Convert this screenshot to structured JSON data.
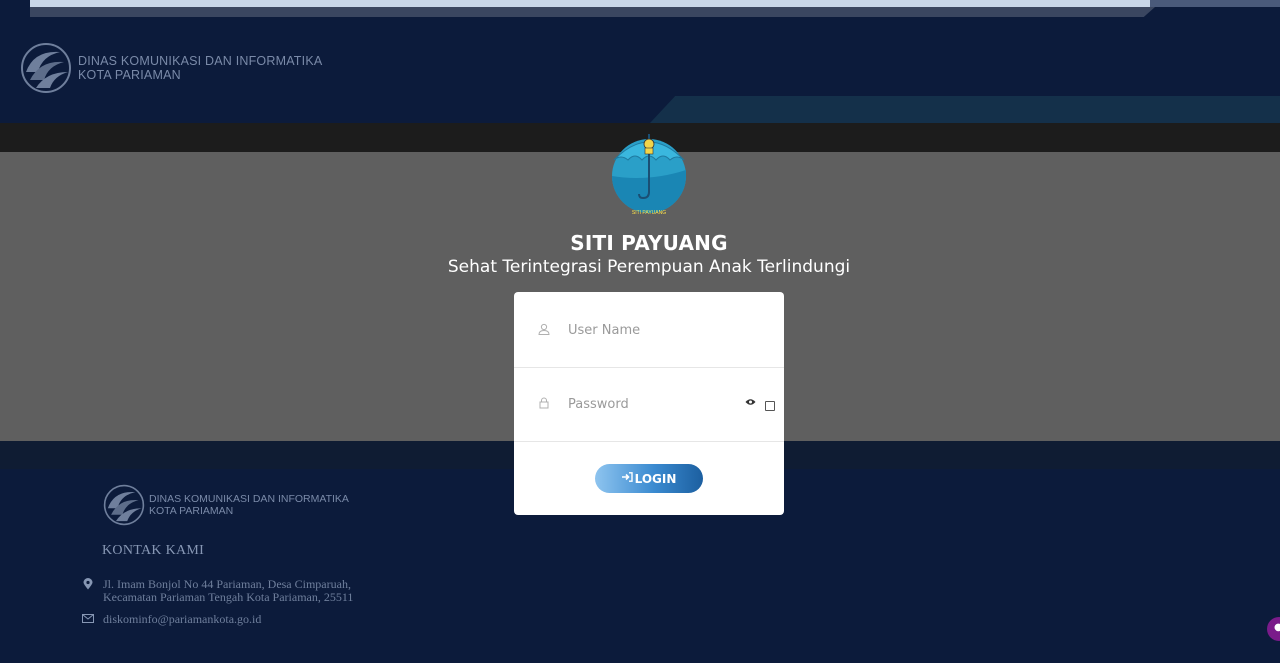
{
  "header": {
    "org_line1": "DINAS KOMUNIKASI DAN INFORMATIKA",
    "org_line2": "KOTA PARIAMAN"
  },
  "app": {
    "logo_caption": "SITI PAYUANG",
    "title": "SITI PAYUANG",
    "subtitle": "Sehat Terintegrasi Perempuan Anak Terlindungi"
  },
  "login": {
    "username_placeholder": "User Name",
    "password_placeholder": "Password",
    "login_label": "LOGIN",
    "user_icon": "user-icon",
    "lock_icon": "lock-icon",
    "eye_icon": "eye-icon",
    "button_icon": "sign-in-icon"
  },
  "footer": {
    "org_line1": "DINAS KOMUNIKASI DAN INFORMATIKA",
    "org_line2": "KOTA PARIAMAN",
    "contact_title": "KONTAK KAMI",
    "address_line1": "Jl. Imam Bonjol No 44 Pariaman, Desa Cimparuah,",
    "address_line2": "Kecamatan Pariaman Tengah Kota Pariaman, 25511",
    "email": "diskominfo@pariamankota.go.id"
  },
  "colors": {
    "header_bg": "#0c1b3b",
    "overlay_gray": "#5f5f5f",
    "login_button": "#3a8ad0"
  }
}
